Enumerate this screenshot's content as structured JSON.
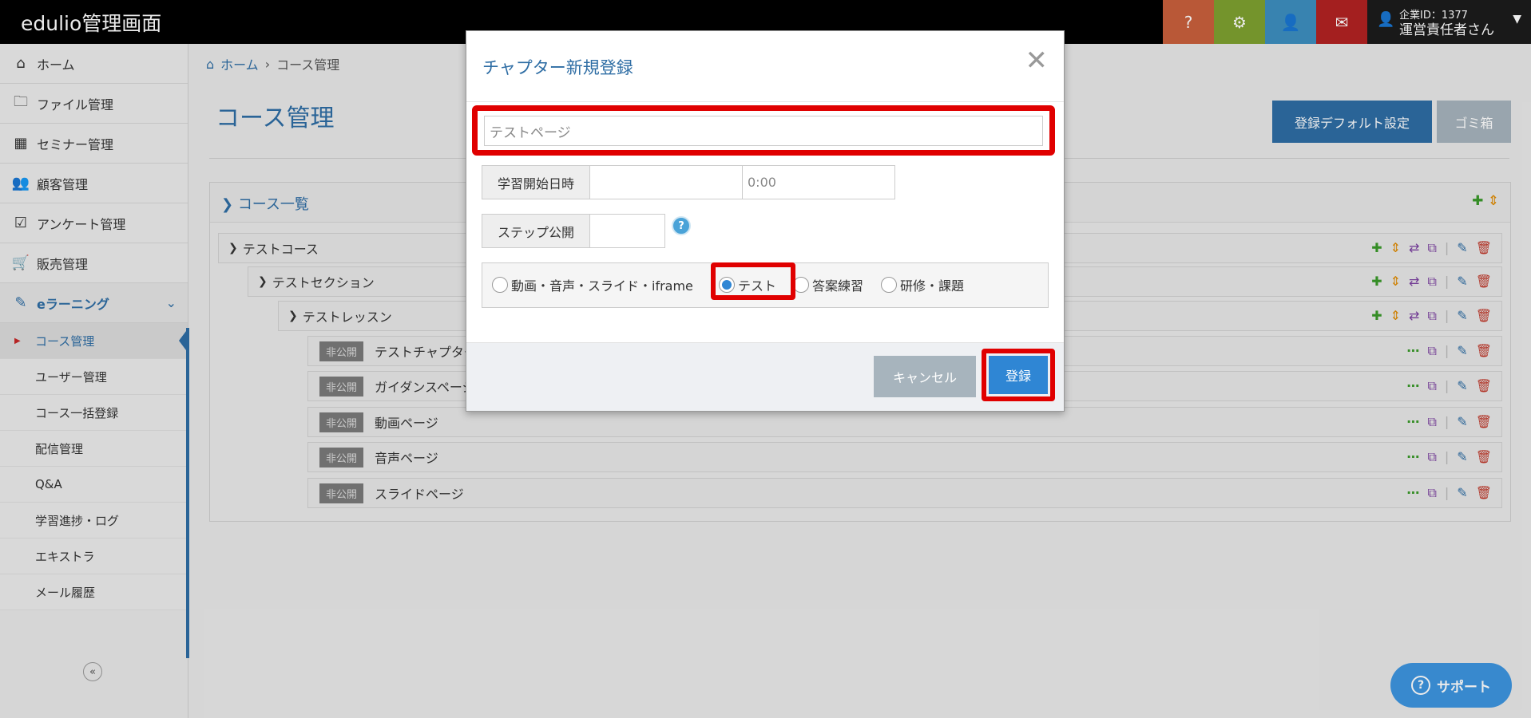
{
  "app": {
    "title": "edulio管理画面"
  },
  "topbar": {
    "buttons": [
      {
        "icon": "question-icon",
        "glyph": "?",
        "color": "#c9603c"
      },
      {
        "icon": "gear-icon",
        "glyph": "⚙",
        "color": "#7ea130"
      },
      {
        "icon": "user-icon",
        "glyph": "👤",
        "color": "#3d8fbf"
      },
      {
        "icon": "mail-icon",
        "glyph": "✉",
        "color": "#b22222"
      }
    ],
    "user": {
      "company_id": "企業ID：1377",
      "name": "運営責任者さん",
      "icon": "user-icon"
    }
  },
  "sidebar": {
    "items": [
      {
        "label": "ホーム",
        "icon": "home-icon",
        "glyph": "⌂"
      },
      {
        "label": "ファイル管理",
        "icon": "folder-icon",
        "glyph": "🗀"
      },
      {
        "label": "セミナー管理",
        "icon": "calendar-icon",
        "glyph": "▦"
      },
      {
        "label": "顧客管理",
        "icon": "users-icon",
        "glyph": "👥"
      },
      {
        "label": "アンケート管理",
        "icon": "checkbox-icon",
        "glyph": "☑"
      },
      {
        "label": "販売管理",
        "icon": "cart-icon",
        "glyph": "🛒"
      },
      {
        "label": "eラーニング",
        "icon": "pencil-icon",
        "glyph": "✎"
      }
    ],
    "sub_items": [
      {
        "label": "コース管理"
      },
      {
        "label": "ユーザー管理"
      },
      {
        "label": "コース一括登録"
      },
      {
        "label": "配信管理"
      },
      {
        "label": "Q&A"
      },
      {
        "label": "学習進捗・ログ"
      },
      {
        "label": "エキストラ"
      },
      {
        "label": "メール履歴"
      }
    ]
  },
  "breadcrumb": {
    "home": "ホーム",
    "sep": "›",
    "current": "コース管理"
  },
  "page": {
    "title": "コース管理",
    "default_settings_button": "登録デフォルト設定",
    "trash_button": "ゴミ箱"
  },
  "course_panel": {
    "title": "コース一覧",
    "course": "テストコース",
    "section": "テストセクション",
    "lesson": "テストレッスン",
    "chapters": [
      {
        "status": "非公開",
        "title": "テストチャプター"
      },
      {
        "status": "非公開",
        "title": "ガイダンスページ"
      },
      {
        "status": "非公開",
        "title": "動画ページ"
      },
      {
        "status": "非公開",
        "title": "音声ページ"
      },
      {
        "status": "非公開",
        "title": "スライドページ"
      }
    ]
  },
  "modal": {
    "title": "チャプター新規登録",
    "name_value": "テストページ",
    "start_label": "学習開始日時",
    "start_date": "",
    "start_time_placeholder": "0:00",
    "step_label": "ステップ公開",
    "step_value": "",
    "types": [
      {
        "label": "動画・音声・スライド・iframe",
        "selected": false
      },
      {
        "label": "テスト",
        "selected": true
      },
      {
        "label": "答案練習",
        "selected": false
      },
      {
        "label": "研修・課題",
        "selected": false
      }
    ],
    "cancel_button": "キャンセル",
    "submit_button": "登録"
  },
  "support": {
    "label": "サポート"
  }
}
